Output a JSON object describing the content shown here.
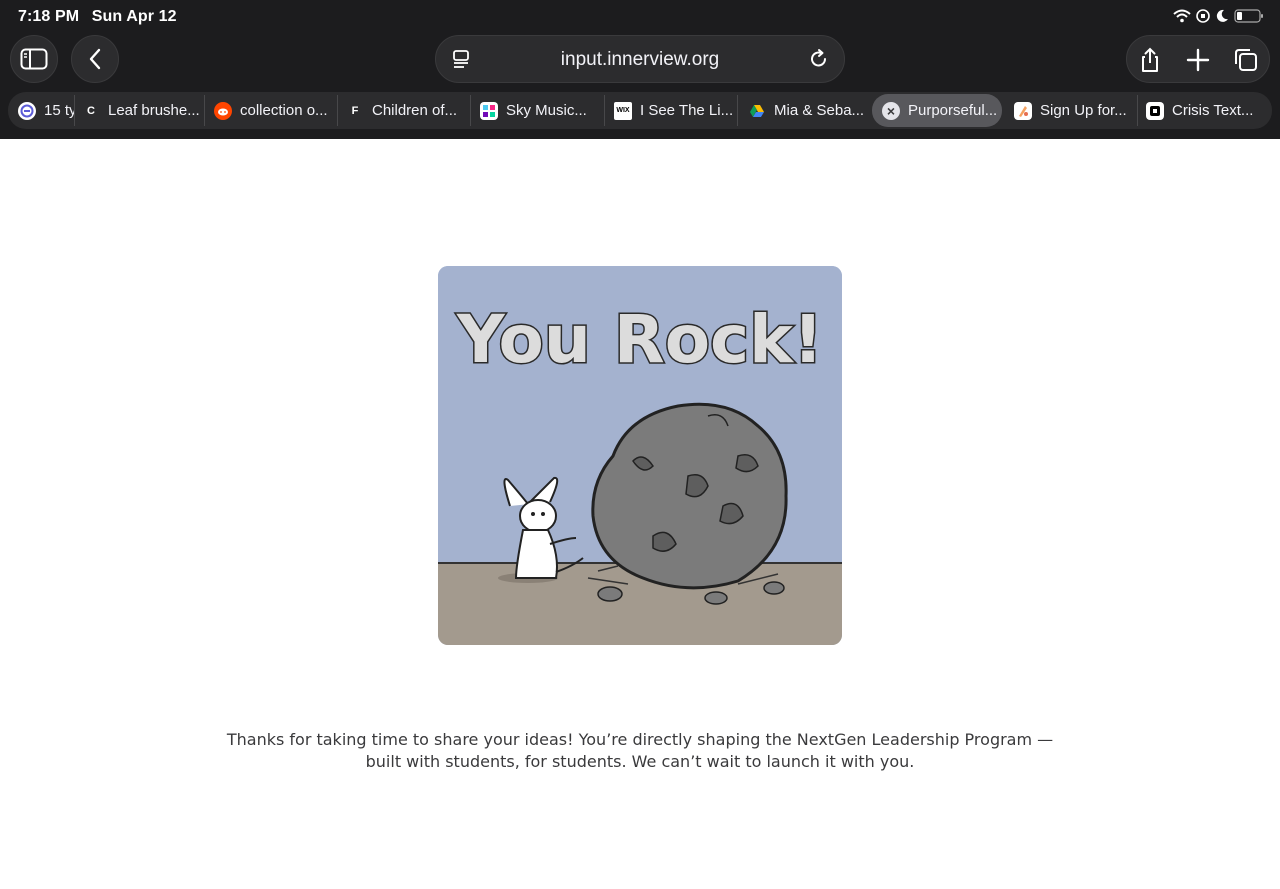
{
  "status_bar": {
    "time": "7:18 PM",
    "date": "Sun Apr 12"
  },
  "address_bar": {
    "url": "input.innerview.org"
  },
  "tabs": [
    {
      "label": "15 ty",
      "favicon_char": "",
      "favicon_bg": "#5b5bd6"
    },
    {
      "label": "Leaf brushe...",
      "favicon_char": "C",
      "favicon_bg": "#2c2c2e"
    },
    {
      "label": "collection o...",
      "favicon_char": "",
      "favicon_bg": "#ff4500"
    },
    {
      "label": "Children of...",
      "favicon_char": "F",
      "favicon_bg": "#2c2c2e"
    },
    {
      "label": "Sky Music...",
      "favicon_char": "",
      "favicon_bg": "#ffffff"
    },
    {
      "label": "I See The Li...",
      "favicon_char": "WIX",
      "favicon_bg": "#ffffff"
    },
    {
      "label": "Mia & Seba...",
      "favicon_char": "",
      "favicon_bg": "#2c2c2e"
    },
    {
      "label": "Purporseful...",
      "favicon_char": "×",
      "favicon_bg": "#e5e5ea"
    },
    {
      "label": "Sign Up for...",
      "favicon_char": "",
      "favicon_bg": "#ffffff"
    },
    {
      "label": "Crisis Text...",
      "favicon_char": "",
      "favicon_bg": "#ffffff"
    }
  ],
  "hero_image": {
    "text": "You Rock!"
  },
  "message": {
    "line1": "Thanks for taking  time to share your ideas! You’re directly shaping the NextGen Leadership Program —",
    "line2": "built with students, for students. We can’t wait to launch it with you."
  }
}
